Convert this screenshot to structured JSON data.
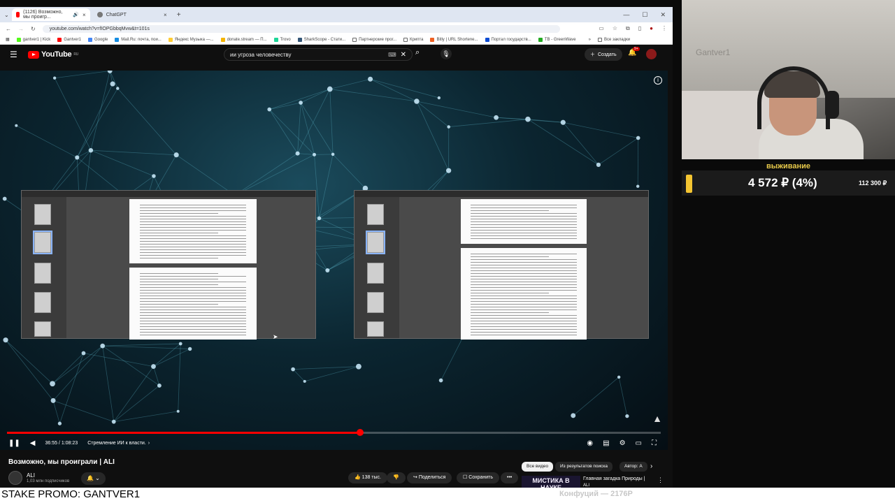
{
  "browser": {
    "tabs": [
      {
        "label": "(1126) Возможно, мы проигр...",
        "active": true
      },
      {
        "label": "ChatGPT",
        "active": false
      }
    ],
    "new_tab": "+",
    "url": "youtube.com/watch?v=fIOPGbbqMvw&t=101s",
    "bookmarks": [
      "gantver1 | Kick",
      "Gantver1",
      "Google",
      "Mail.Ru: почта, пои...",
      "Яндекс Музыка —...",
      "donate.stream — П...",
      "Trovo",
      "SharkScope - Стати...",
      "Партнерские прог...",
      "Крипта",
      "Bitly | URL Shortene...",
      "Портал государств...",
      "TB - GreenWave"
    ],
    "all_bookmarks": "Все закладки"
  },
  "youtube": {
    "logo": "YouTube",
    "logo_region": "RU",
    "search_query": "ии угроза человечеству",
    "create_label": "Создать",
    "notif_count": "9+"
  },
  "player": {
    "time": "36:55 / 1:08:23",
    "chapter": "Стремление ИИ к власти.",
    "progress_fraction": 0.54
  },
  "video": {
    "title": "Возможно, мы проиграли | ALI",
    "channel": "ALI",
    "subscribers": "1,03 млн подписчиков",
    "likes": "138 тыс.",
    "share": "Поделиться",
    "save": "Сохранить",
    "more": "•••"
  },
  "filters": [
    "Все видео",
    "Из результатов поиска",
    "Автор: А"
  ],
  "recommendation": {
    "thumb_text": "МИСТИКА В НАУКЕ",
    "title": "Главная загадка Природы |",
    "channel": "ALI"
  },
  "overlay": {
    "title": "выживание",
    "amount": "4 572 ₽ (4%)",
    "goal": "112 300 ₽",
    "progress_fraction": 0.04
  },
  "webcam": {
    "wall_text": "Gantver1"
  },
  "footer": {
    "promo": "STAKE PROMO: GANTVER1",
    "right_text": "Конфуций — 2176Р"
  }
}
